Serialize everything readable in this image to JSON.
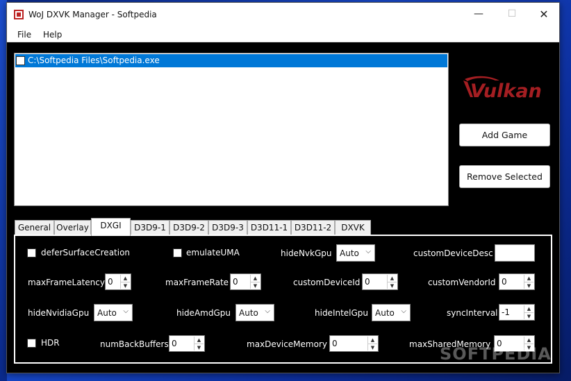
{
  "window": {
    "title": "WoJ DXVK Manager - Softpedia",
    "minimize_glyph": "—",
    "maximize_glyph": "☐",
    "close_glyph": "✕"
  },
  "menu": {
    "file": "File",
    "help": "Help"
  },
  "games": {
    "items": [
      {
        "path": "C:\\Softpedia Files\\Softpedia.exe",
        "checked": false,
        "selected": true
      }
    ]
  },
  "logo": {
    "text": "Vulkan",
    "color": "#a41e22",
    "icon": "vulkan-logo"
  },
  "buttons": {
    "add_game": "Add Game",
    "remove_selected": "Remove Selected"
  },
  "tabs": {
    "items": [
      "General",
      "Overlay",
      "DXGI",
      "D3D9-1",
      "D3D9-2",
      "D3D9-3",
      "D3D11-1",
      "D3D11-2",
      "DXVK"
    ],
    "active": "DXGI"
  },
  "dxgi": {
    "deferSurfaceCreation": {
      "label": "deferSurfaceCreation",
      "checked": false
    },
    "emulateUMA": {
      "label": "emulateUMA",
      "checked": false
    },
    "hideNvkGpu": {
      "label": "hideNvkGpu",
      "value": "Auto"
    },
    "customDeviceDesc": {
      "label": "customDeviceDesc",
      "value": ""
    },
    "maxFrameLatency": {
      "label": "maxFrameLatency",
      "value": "0"
    },
    "maxFrameRate": {
      "label": "maxFrameRate",
      "value": "0"
    },
    "customDeviceId": {
      "label": "customDeviceId",
      "value": "0"
    },
    "customVendorId": {
      "label": "customVendorId",
      "value": "0"
    },
    "hideNvidiaGpu": {
      "label": "hideNvidiaGpu",
      "value": "Auto"
    },
    "hideAmdGpu": {
      "label": "hideAmdGpu",
      "value": "Auto"
    },
    "hideIntelGpu": {
      "label": "hideIntelGpu",
      "value": "Auto"
    },
    "syncInterval": {
      "label": "syncInterval",
      "value": "-1"
    },
    "HDR": {
      "label": "HDR",
      "checked": false
    },
    "numBackBuffers": {
      "label": "numBackBuffers",
      "value": "0"
    },
    "maxDeviceMemory": {
      "label": "maxDeviceMemory",
      "value": "0"
    },
    "maxSharedMemory": {
      "label": "maxSharedMemory",
      "value": "0"
    }
  },
  "watermark": "SOFTPEDIA"
}
